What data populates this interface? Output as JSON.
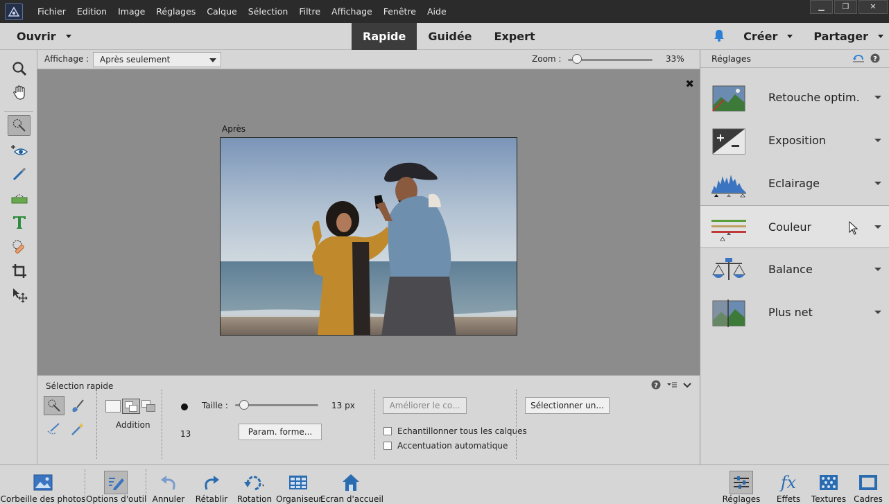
{
  "menubar": {
    "items": [
      "Fichier",
      "Edition",
      "Image",
      "Réglages",
      "Calque",
      "Sélection",
      "Filtre",
      "Affichage",
      "Fenêtre",
      "Aide"
    ],
    "window_buttons": [
      "▁",
      "❐",
      "✕"
    ]
  },
  "modebar": {
    "open_label": "Ouvrir",
    "tabs": [
      "Rapide",
      "Guidée",
      "Expert"
    ],
    "active_tab": "Rapide",
    "create_label": "Créer",
    "share_label": "Partager"
  },
  "toolbar": {
    "tools": [
      "zoom-icon",
      "hand-icon",
      "quick-selection-icon",
      "red-eye-icon",
      "whiten-teeth-icon",
      "straighten-icon",
      "text-icon",
      "spot-healing-icon",
      "crop-icon",
      "move-icon"
    ]
  },
  "options_strip": {
    "view_label": "Affichage :",
    "view_value": "Après seulement",
    "zoom_label": "Zoom :",
    "zoom_value": "33%",
    "zoom_fraction": 0.05
  },
  "canvas": {
    "image_label": "Après",
    "close_glyph": "✖"
  },
  "tool_options": {
    "title": "Sélection rapide",
    "mode_label": "Addition",
    "size_label": "Taille :",
    "size_value": "13 px",
    "size_fraction": 0.05,
    "brush_size": "13",
    "shape_button": "Param. forme...",
    "refine_button": "Améliorer le co...",
    "select_button": "Sélectionner un...",
    "checkbox_all_layers": "Echantillonner tous les calques",
    "checkbox_auto_enhance": "Accentuation automatique"
  },
  "right_panel": {
    "title": "Réglages",
    "adjustments": [
      {
        "label": "Retouche optim.",
        "icon": "smart-fix-icon"
      },
      {
        "label": "Exposition",
        "icon": "exposure-icon"
      },
      {
        "label": "Eclairage",
        "icon": "lighting-icon"
      },
      {
        "label": "Couleur",
        "icon": "color-icon"
      },
      {
        "label": "Balance",
        "icon": "balance-icon"
      },
      {
        "label": "Plus net",
        "icon": "sharpen-icon"
      }
    ]
  },
  "bottombar": {
    "left": [
      {
        "label": "Corbeille des photos",
        "icon": "photo-bin-icon"
      },
      {
        "label": "Options d'outil",
        "icon": "tool-options-icon"
      },
      {
        "label": "Annuler",
        "icon": "undo-icon"
      },
      {
        "label": "Rétablir",
        "icon": "redo-icon"
      },
      {
        "label": "Rotation",
        "icon": "rotate-icon"
      },
      {
        "label": "Organiseur",
        "icon": "organizer-icon"
      },
      {
        "label": "Ecran d'accueil",
        "icon": "home-icon"
      }
    ],
    "right": [
      {
        "label": "Réglages",
        "icon": "adjustments-icon"
      },
      {
        "label": "Effets",
        "icon": "effects-icon",
        "glyph": "fx"
      },
      {
        "label": "Textures",
        "icon": "textures-icon"
      },
      {
        "label": "Cadres",
        "icon": "frames-icon"
      }
    ]
  },
  "colors": {
    "menubar_bg": "#2b2b2b",
    "panel_bg": "#d6d6d6",
    "canvas_bg": "#8c8c8c",
    "accent_blue": "#2b7fd4"
  }
}
